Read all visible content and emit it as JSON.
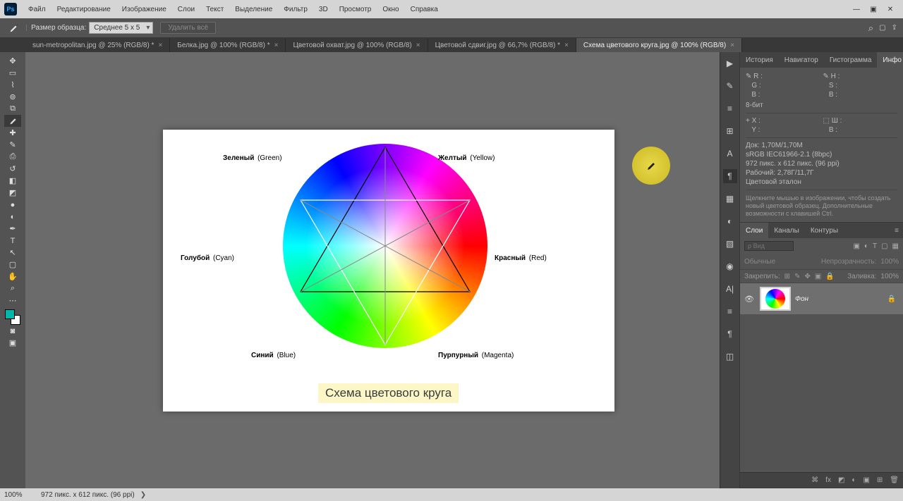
{
  "menu": {
    "items": [
      "Файл",
      "Редактирование",
      "Изображение",
      "Слои",
      "Текст",
      "Выделение",
      "Фильтр",
      "3D",
      "Просмотр",
      "Окно",
      "Справка"
    ]
  },
  "options": {
    "sample_label": "Размер образца:",
    "sample_value": "Среднее 5 x 5",
    "delete_all": "Удалить всё"
  },
  "tabs": [
    {
      "label": "sun-metropolitan.jpg @ 25% (RGB/8) *"
    },
    {
      "label": "Белка.jpg @ 100% (RGB/8) *"
    },
    {
      "label": "Цветовой охват.jpg @ 100% (RGB/8)"
    },
    {
      "label": "Цветовой сдвиг.jpg @ 66,7% (RGB/8) *"
    },
    {
      "label": "Схема цветового круга.jpg @ 100% (RGB/8)",
      "active": true
    }
  ],
  "document": {
    "labels": {
      "green": "Зеленый",
      "green_en": "(Green)",
      "yellow": "Желтый",
      "yellow_en": "(Yellow)",
      "cyan": "Голубой",
      "cyan_en": "(Cyan)",
      "red": "Красный",
      "red_en": "(Red)",
      "blue": "Синий",
      "blue_en": "(Blue)",
      "magenta": "Пурпурный",
      "magenta_en": "(Magenta)"
    },
    "caption": "Схема цветового круга"
  },
  "panels": {
    "top_tabs": [
      "История",
      "Навигатор",
      "Гистограмма",
      "Инфо"
    ],
    "info": {
      "rgb": {
        "R": "R :",
        "G": "G :",
        "B": "B :"
      },
      "hsb": {
        "H": "H :",
        "S": "S :",
        "B": "B :"
      },
      "bit": "8-бит",
      "xy": {
        "X": "X :",
        "Y": "Y :"
      },
      "wh": {
        "W": "Ш :",
        "H": "В :"
      },
      "doc": "Док: 1,70M/1,70M",
      "profile": "sRGB IEC61966-2.1 (8bpc)",
      "dims": "972 пикс. x 612 пикс. (96 ppi)",
      "work": "Рабочий: 2,78Г/11,7Г",
      "ref": "Цветовой эталон",
      "help": "Щелкните мышью в изображении, чтобы создать новый цветовой образец. Дополнительные возможности с клавишей Ctrl."
    },
    "layer_tabs": [
      "Слои",
      "Каналы",
      "Контуры"
    ],
    "layer": {
      "search_placeholder": "ρ Вид",
      "blend": "Обычные",
      "opacity_label": "Непрозрачность:",
      "opacity_value": "100%",
      "lock_label": "Закрепить:",
      "fill_label": "Заливка:",
      "fill_value": "100%",
      "layer_name": "Фон"
    }
  },
  "status": {
    "zoom": "100%",
    "dims": "972 пикс. x 612 пикс. (96 ppi)"
  }
}
